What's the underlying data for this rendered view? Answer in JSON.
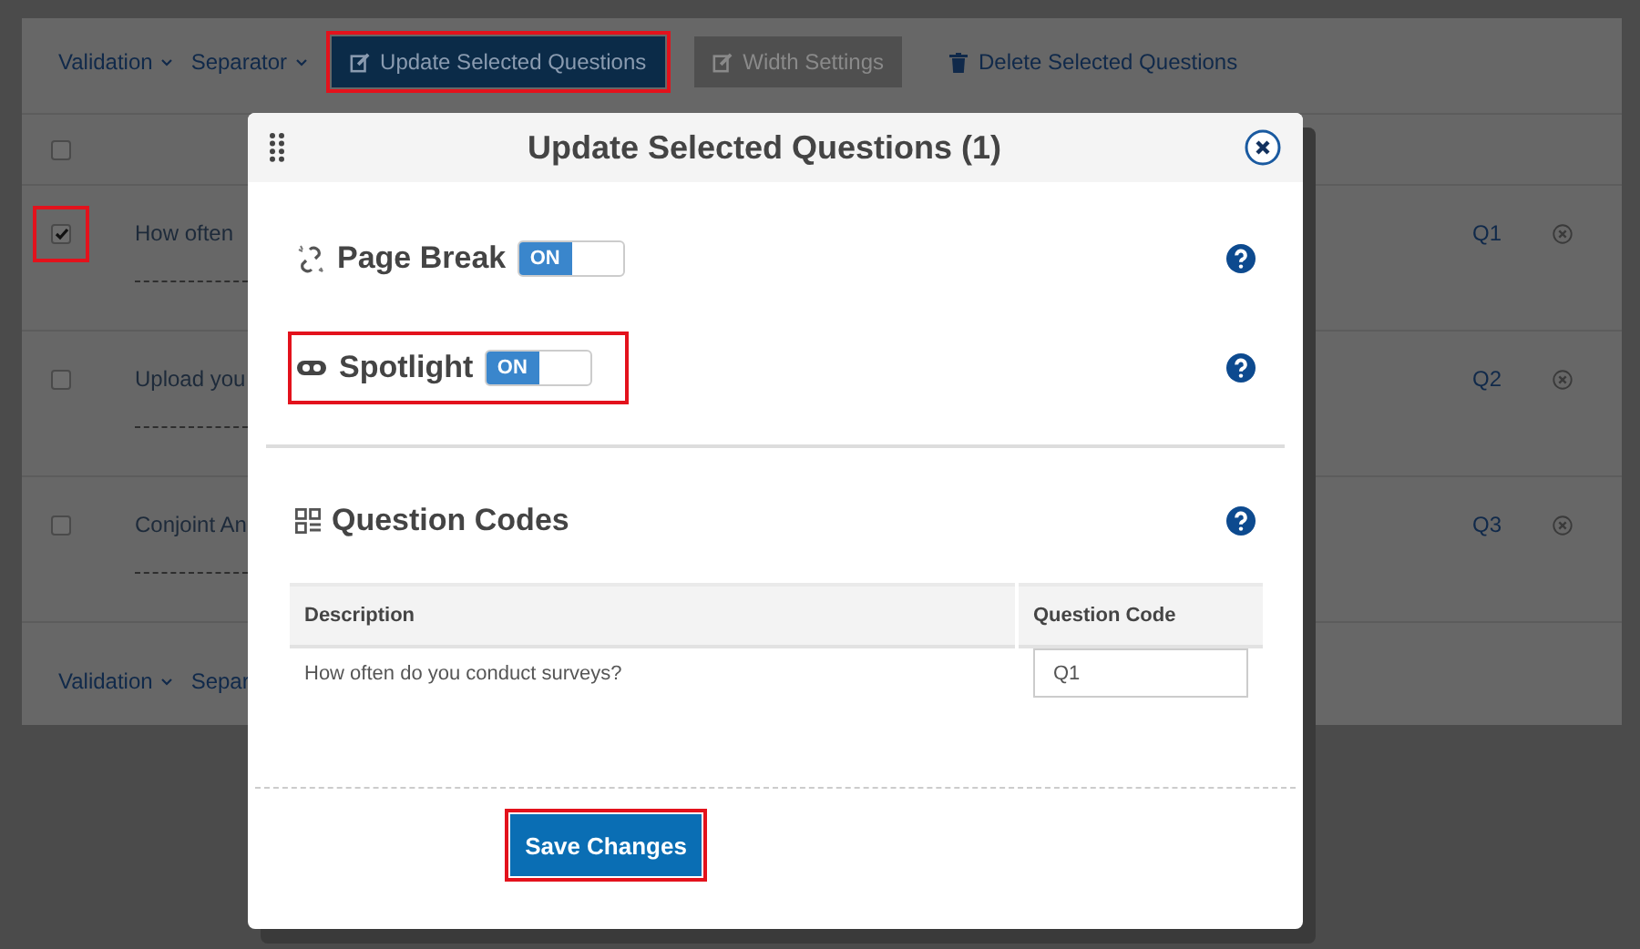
{
  "toolbar": {
    "menus": [
      {
        "label": "Validation"
      },
      {
        "label": "Separator"
      }
    ],
    "buttons": [
      {
        "kind": "primary",
        "label": "Update Selected Questions",
        "highlighted": true
      },
      {
        "kind": "disabled",
        "label": "Width Settings",
        "highlighted": false
      },
      {
        "kind": "link",
        "label": "Delete Selected Questions",
        "highlighted": false
      }
    ]
  },
  "questions": {
    "header": {
      "checked": false
    },
    "rows": [
      {
        "text": "How often",
        "code": "Q1",
        "checked": true,
        "highlighted": true
      },
      {
        "text": "Upload you",
        "code": "Q2",
        "checked": false,
        "highlighted": false
      },
      {
        "text": "Conjoint An",
        "code": "Q3",
        "checked": false,
        "highlighted": false
      }
    ]
  },
  "bottom_toolbar": {
    "menus": [
      {
        "label": "Validation"
      },
      {
        "label": "Separ"
      }
    ]
  },
  "dialog": {
    "title": "Update Selected Questions (1)",
    "settings": [
      {
        "kind": "page-break",
        "label": "Page Break",
        "toggle": "ON",
        "on": true,
        "highlighted": false
      },
      {
        "kind": "spotlight",
        "label": "Spotlight",
        "toggle": "ON",
        "on": true,
        "highlighted": true
      }
    ],
    "codes": {
      "title": "Question Codes",
      "columns": [
        "Description",
        "Question Code"
      ],
      "rows": [
        {
          "description": "How often do you conduct surveys?",
          "code": "Q1"
        }
      ]
    },
    "save_button": {
      "label": "Save Changes",
      "highlighted": true
    }
  }
}
